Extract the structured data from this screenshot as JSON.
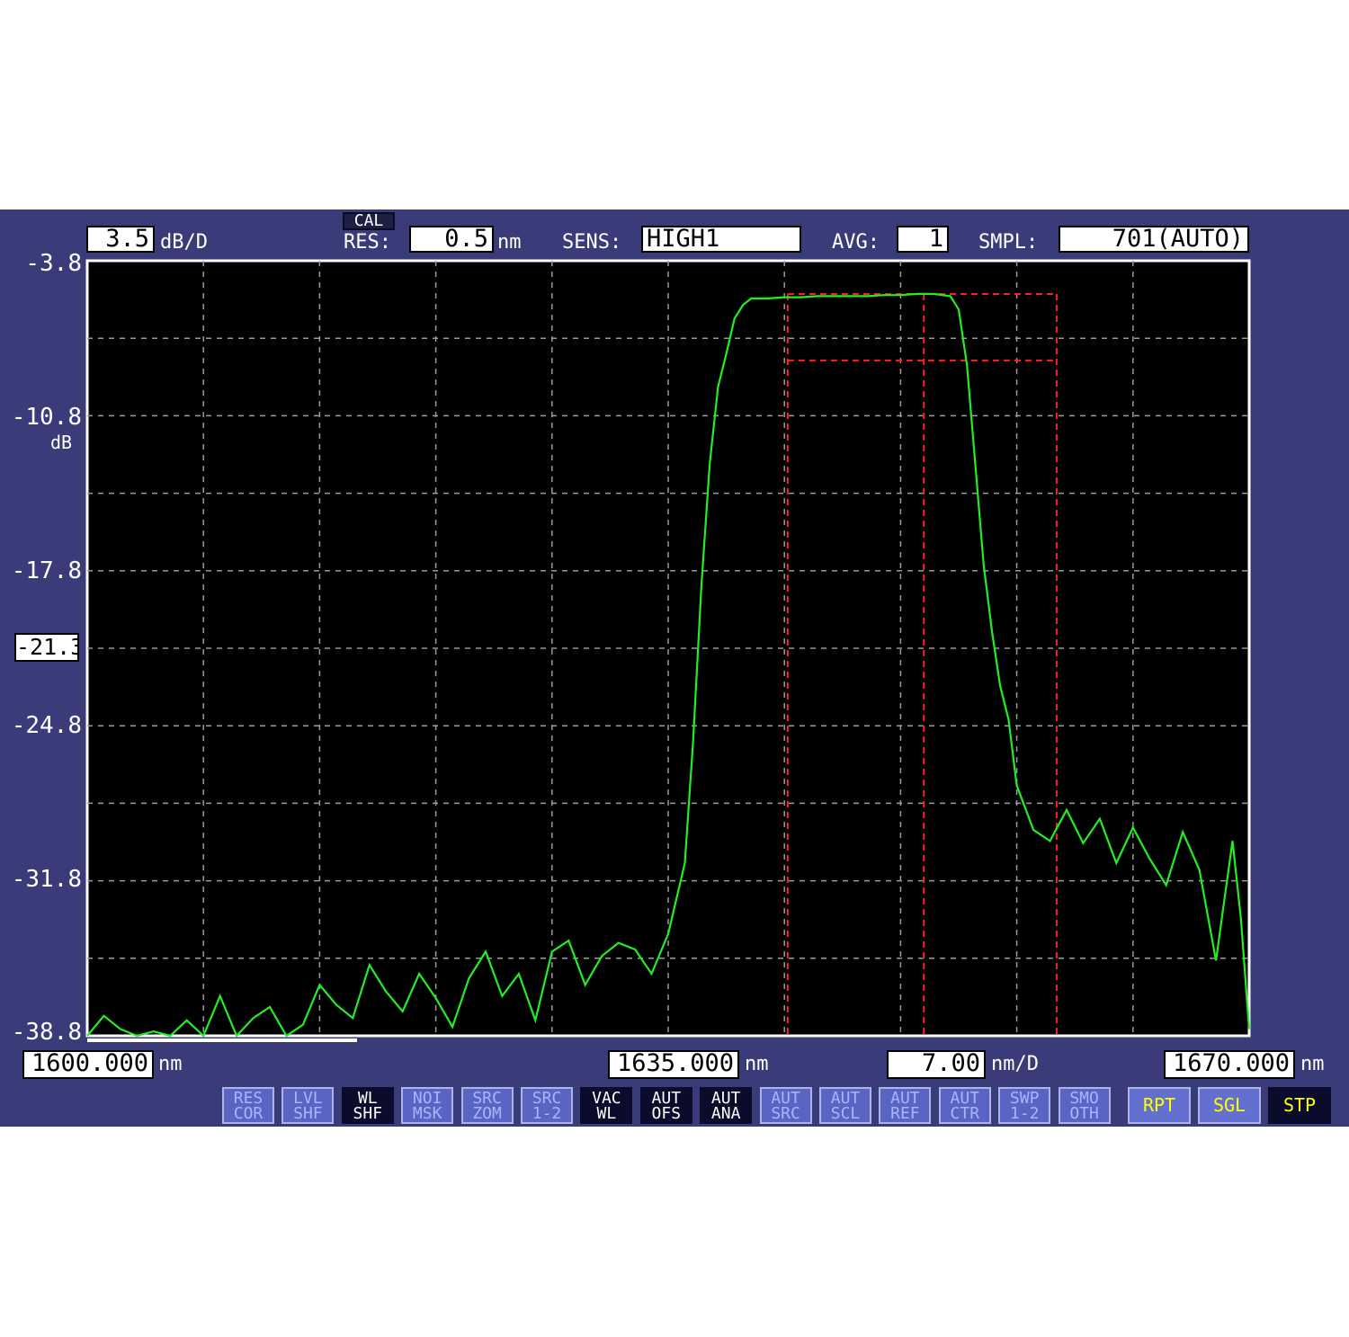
{
  "header": {
    "scale_value": "3.5",
    "scale_unit": "dB/D",
    "cal_label": "CAL",
    "res_label": "RES:",
    "res_value": "0.5",
    "res_unit": "nm",
    "sens_label": "SENS:",
    "sens_value": "HIGH1",
    "avg_label": "AVG:",
    "avg_value": "1",
    "smpl_label": "SMPL:",
    "smpl_value": "701(AUTO)"
  },
  "y_axis": {
    "labels": [
      "-3.8",
      "-10.8",
      "-17.8",
      "-24.8",
      "-31.8",
      "-38.8"
    ],
    "unit": "dB",
    "ref_level": "-21.3"
  },
  "x_axis": {
    "start_value": "1600.000",
    "start_unit": "nm",
    "center_value": "1635.000",
    "center_unit": "nm",
    "span_value": "7.00",
    "span_unit": "nm/D",
    "stop_value": "1670.000",
    "stop_unit": "nm"
  },
  "softkeys": [
    {
      "line1": "RES",
      "line2": "COR",
      "active": false
    },
    {
      "line1": "LVL",
      "line2": "SHF",
      "active": false
    },
    {
      "line1": "WL",
      "line2": "SHF",
      "active": true
    },
    {
      "line1": "NOI",
      "line2": "MSK",
      "active": false
    },
    {
      "line1": "SRC",
      "line2": "ZOM",
      "active": false
    },
    {
      "line1": "SRC",
      "line2": "1-2",
      "active": false
    },
    {
      "line1": "VAC",
      "line2": "WL",
      "active": true
    },
    {
      "line1": "AUT",
      "line2": "OFS",
      "active": true
    },
    {
      "line1": "AUT",
      "line2": "ANA",
      "active": true
    },
    {
      "line1": "AUT",
      "line2": "SRC",
      "active": false
    },
    {
      "line1": "AUT",
      "line2": "SCL",
      "active": false
    },
    {
      "line1": "AUT",
      "line2": "REF",
      "active": false
    },
    {
      "line1": "AUT",
      "line2": "CTR",
      "active": false
    },
    {
      "line1": "SWP",
      "line2": "1-2",
      "active": false
    },
    {
      "line1": "SMO",
      "line2": "OTH",
      "active": false
    }
  ],
  "run_keys": [
    {
      "label": "RPT",
      "active": false
    },
    {
      "label": "SGL",
      "active": false
    },
    {
      "label": "STP",
      "active": true
    }
  ],
  "colors": {
    "background": "#3a3c7a",
    "plot_background": "#000000",
    "trace": "#22ee22",
    "markers": "#ff2020",
    "grid": "#9a9a9a"
  },
  "chart_data": {
    "type": "line",
    "title": "",
    "xlabel": "nm",
    "ylabel": "dB",
    "xlim": [
      1600,
      1670
    ],
    "ylim": [
      -38.8,
      -3.8
    ],
    "grid": true,
    "series": [
      {
        "x": [
          1600,
          1601,
          1602,
          1603,
          1604,
          1605,
          1606,
          1607,
          1608,
          1609,
          1610,
          1611,
          1612,
          1613,
          1614,
          1615,
          1616,
          1617,
          1618,
          1619,
          1620,
          1621,
          1622,
          1623,
          1624,
          1625,
          1626,
          1627,
          1628,
          1629,
          1630,
          1631,
          1632,
          1633,
          1634,
          1635,
          1636,
          1636.5,
          1637,
          1637.5,
          1638,
          1638.5,
          1639,
          1639.5,
          1640,
          1641,
          1642,
          1643,
          1644,
          1645,
          1646,
          1647,
          1648,
          1649,
          1650,
          1651,
          1652,
          1652.5,
          1653,
          1653.5,
          1654,
          1654.5,
          1655,
          1655.5,
          1656,
          1657,
          1658,
          1659,
          1660,
          1661,
          1662,
          1663,
          1664,
          1665,
          1666,
          1667,
          1668,
          1669,
          1669.5,
          1670
        ],
        "y": [
          -38.8,
          -37.9,
          -38.5,
          -38.8,
          -38.6,
          -38.8,
          -38.1,
          -38.8,
          -37.0,
          -38.8,
          -38.0,
          -37.5,
          -38.8,
          -38.3,
          -36.5,
          -37.4,
          -38.0,
          -35.6,
          -36.8,
          -37.7,
          -36.0,
          -37.1,
          -38.4,
          -36.2,
          -35.0,
          -37.0,
          -36.0,
          -38.1,
          -35.0,
          -34.5,
          -36.5,
          -35.2,
          -34.6,
          -34.9,
          -36.0,
          -34.2,
          -31.0,
          -25.5,
          -18.5,
          -13.0,
          -9.5,
          -8.0,
          -6.4,
          -5.8,
          -5.5,
          -5.5,
          -5.45,
          -5.45,
          -5.4,
          -5.4,
          -5.4,
          -5.4,
          -5.35,
          -5.35,
          -5.3,
          -5.3,
          -5.4,
          -6.0,
          -8.5,
          -13.0,
          -17.5,
          -20.5,
          -23.0,
          -24.5,
          -27.5,
          -29.5,
          -30.0,
          -28.6,
          -30.1,
          -29.0,
          -31.0,
          -29.4,
          -30.8,
          -32.0,
          -29.6,
          -31.3,
          -35.4,
          -30.0,
          -33.5,
          -38.5
        ]
      }
    ],
    "markers": {
      "vertical_lines_nm": [
        1642.2,
        1650.4,
        1658.4
      ],
      "horizontal_lines_dB": [
        -5.3,
        -8.3
      ]
    }
  }
}
